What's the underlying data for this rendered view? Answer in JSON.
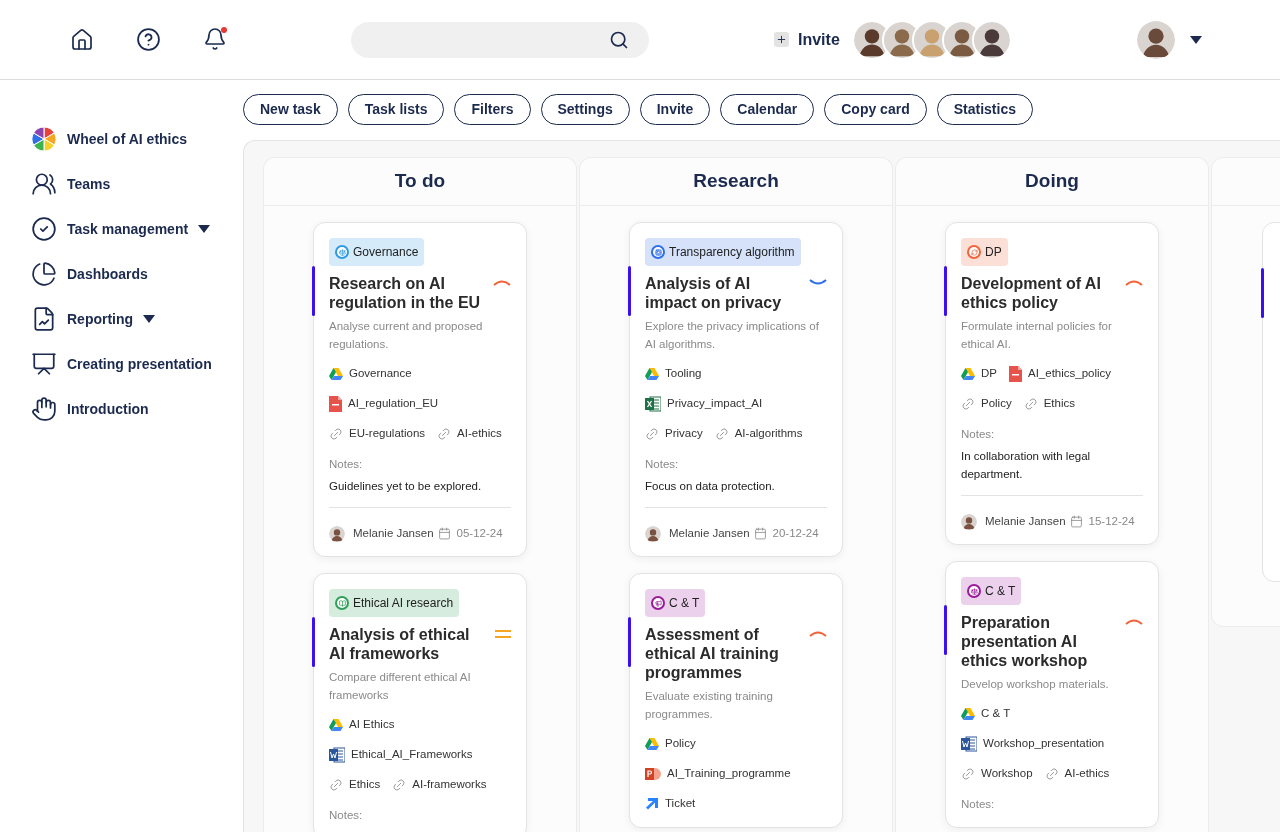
{
  "header": {
    "invite": "Invite",
    "team_avatars": [
      {
        "color": "#5a3a2a"
      },
      {
        "color": "#8a6a4a"
      },
      {
        "color": "#c9a070"
      },
      {
        "color": "#7a5a40"
      },
      {
        "color": "#4a3a3a"
      }
    ]
  },
  "toolbar": [
    "New task",
    "Task lists",
    "Filters",
    "Settings",
    "Invite",
    "Calendar",
    "Copy card",
    "Statistics"
  ],
  "sidebar": {
    "items": [
      {
        "label": "Wheel of AI ethics",
        "kind": "wheel",
        "has_menu": false
      },
      {
        "label": "Teams",
        "kind": "teams",
        "has_menu": false
      },
      {
        "label": "Task management",
        "kind": "tasks",
        "has_menu": true
      },
      {
        "label": "Dashboards",
        "kind": "dashboards",
        "has_menu": false
      },
      {
        "label": "Reporting",
        "kind": "reporting",
        "has_menu": true
      },
      {
        "label": "Creating presentation",
        "kind": "presentation",
        "has_menu": false
      },
      {
        "label": "Introduction",
        "kind": "introduction",
        "has_menu": false
      }
    ]
  },
  "columns": [
    {
      "title": "To do",
      "cards": [
        {
          "tag": {
            "label": "Governance",
            "color": "#2e9be0"
          },
          "title": "Research on AI regulation in the EU",
          "priority": {
            "kind": "high"
          },
          "description": "Analyse current and proposed regulations.",
          "attachments": [
            [
              {
                "kind": "drive",
                "label": "Governance"
              }
            ],
            [
              {
                "kind": "pdf",
                "label": "AI_regulation_EU"
              }
            ],
            [
              {
                "kind": "link",
                "label": "EU-regulations"
              },
              {
                "kind": "link",
                "label": "AI-ethics"
              }
            ]
          ],
          "notes_label": "Notes:",
          "notes": "Guidelines yet to be explored.",
          "assignee": "Melanie Jansen",
          "date": "05-12-24"
        },
        {
          "tag": {
            "label": "Ethical AI research",
            "color": "#2ea05a"
          },
          "title": "Analysis of ethical AI frameworks",
          "priority": {
            "kind": "medium"
          },
          "description": "Compare different ethical AI frameworks",
          "attachments": [
            [
              {
                "kind": "drive",
                "label": "AI Ethics"
              }
            ],
            [
              {
                "kind": "word",
                "label": "Ethical_AI_Frameworks"
              }
            ],
            [
              {
                "kind": "link",
                "label": "Ethics"
              },
              {
                "kind": "link",
                "label": "AI-frameworks"
              }
            ]
          ],
          "notes_label": "Notes:"
        }
      ]
    },
    {
      "title": "Research",
      "cards": [
        {
          "tag": {
            "label": "Transparency algorithm",
            "color": "#2f6fe8"
          },
          "title": "Analysis of AI impact on privacy",
          "priority": {
            "kind": "low"
          },
          "description": "Explore the privacy implications of AI algorithms.",
          "attachments": [
            [
              {
                "kind": "drive",
                "label": "Tooling"
              }
            ],
            [
              {
                "kind": "excel",
                "label": "Privacy_impact_AI"
              }
            ],
            [
              {
                "kind": "link",
                "label": "Privacy"
              },
              {
                "kind": "link",
                "label": "AI-algorithms"
              }
            ]
          ],
          "notes_label": "Notes:",
          "notes": "Focus on data protection.",
          "assignee": "Melanie Jansen",
          "date": "20-12-24"
        },
        {
          "tag": {
            "label": "C & T",
            "color": "#9a1a9a"
          },
          "title": "Assessment of ethical AI training programmes",
          "priority": {
            "kind": "high"
          },
          "description": "Evaluate existing training programmes.",
          "attachments": [
            [
              {
                "kind": "drive",
                "label": "Policy"
              }
            ],
            [
              {
                "kind": "ppt",
                "label": "AI_Training_programme"
              }
            ],
            [
              {
                "kind": "jira",
                "label": "Ticket"
              }
            ]
          ]
        }
      ]
    },
    {
      "title": "Doing",
      "cards": [
        {
          "tag": {
            "label": "DP",
            "color": "#f0643c"
          },
          "title": "Development of AI ethics policy",
          "priority": {
            "kind": "high"
          },
          "description": "Formulate internal policies for ethical AI.",
          "attachments": [
            [
              {
                "kind": "drive",
                "label": "DP"
              },
              {
                "kind": "pdf",
                "label": "AI_ethics_policy"
              }
            ],
            [
              {
                "kind": "link",
                "label": "Policy"
              },
              {
                "kind": "link",
                "label": "Ethics"
              }
            ]
          ],
          "notes_label": "Notes:",
          "notes": "In collaboration with legal department.",
          "assignee": "Melanie Jansen",
          "date": "15-12-24"
        },
        {
          "tag": {
            "label": "C & T",
            "color": "#9a1a9a"
          },
          "title": "Preparation presentation AI ethics workshop",
          "priority": {
            "kind": "high"
          },
          "description": "Develop workshop materials.",
          "attachments": [
            [
              {
                "kind": "drive",
                "label": "C & T"
              }
            ],
            [
              {
                "kind": "word",
                "label": "Workshop_presentation"
              }
            ],
            [
              {
                "kind": "link",
                "label": "Workshop"
              },
              {
                "kind": "link",
                "label": "AI-ethics"
              }
            ]
          ],
          "notes_label": "Notes:"
        }
      ]
    },
    {
      "partial": true
    }
  ]
}
